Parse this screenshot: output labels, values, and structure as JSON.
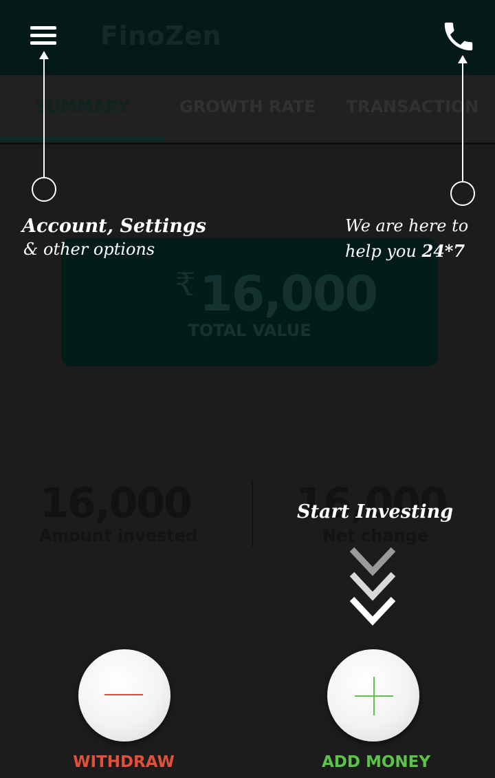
{
  "app": {
    "title": "FinoZen"
  },
  "tabs": [
    {
      "label": "SUMMARY",
      "active": true
    },
    {
      "label": "GROWTH RATE",
      "active": false
    },
    {
      "label": "TRANSACTION",
      "active": false
    }
  ],
  "summary": {
    "currency_symbol": "₹",
    "total_value": "16,000",
    "total_label": "TOTAL VALUE",
    "amount_invested": "16,000",
    "amount_invested_label": "Amount invested",
    "net_change": "16,000",
    "net_change_label": "Net change"
  },
  "hints": {
    "menu_title": "Account, Settings",
    "menu_sub": "& other options",
    "support_line1": "We are here to",
    "support_line2": "help you",
    "support_emphasis": "24*7",
    "invest": "Start Investing"
  },
  "actions": {
    "withdraw_label": "WITHDRAW",
    "add_money_label": "ADD MONEY"
  },
  "colors": {
    "withdraw": "#e0503a",
    "add_money": "#5cc24a",
    "app_bar": "#031a18"
  },
  "icons": {
    "menu": "hamburger-menu",
    "support": "phone",
    "withdraw": "minus",
    "add_money": "plus",
    "hint": "chevron-down-triple"
  }
}
